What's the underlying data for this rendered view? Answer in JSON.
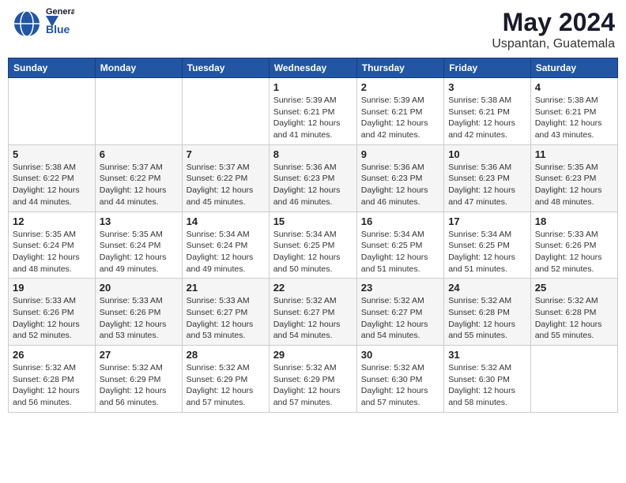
{
  "header": {
    "logo_line1": "General",
    "logo_line2": "Blue",
    "title": "May 2024",
    "subtitle": "Uspantan, Guatemala"
  },
  "days_of_week": [
    "Sunday",
    "Monday",
    "Tuesday",
    "Wednesday",
    "Thursday",
    "Friday",
    "Saturday"
  ],
  "weeks": [
    [
      {
        "day": "",
        "info": ""
      },
      {
        "day": "",
        "info": ""
      },
      {
        "day": "",
        "info": ""
      },
      {
        "day": "1",
        "info": "Sunrise: 5:39 AM\nSunset: 6:21 PM\nDaylight: 12 hours\nand 41 minutes."
      },
      {
        "day": "2",
        "info": "Sunrise: 5:39 AM\nSunset: 6:21 PM\nDaylight: 12 hours\nand 42 minutes."
      },
      {
        "day": "3",
        "info": "Sunrise: 5:38 AM\nSunset: 6:21 PM\nDaylight: 12 hours\nand 42 minutes."
      },
      {
        "day": "4",
        "info": "Sunrise: 5:38 AM\nSunset: 6:21 PM\nDaylight: 12 hours\nand 43 minutes."
      }
    ],
    [
      {
        "day": "5",
        "info": "Sunrise: 5:38 AM\nSunset: 6:22 PM\nDaylight: 12 hours\nand 44 minutes."
      },
      {
        "day": "6",
        "info": "Sunrise: 5:37 AM\nSunset: 6:22 PM\nDaylight: 12 hours\nand 44 minutes."
      },
      {
        "day": "7",
        "info": "Sunrise: 5:37 AM\nSunset: 6:22 PM\nDaylight: 12 hours\nand 45 minutes."
      },
      {
        "day": "8",
        "info": "Sunrise: 5:36 AM\nSunset: 6:23 PM\nDaylight: 12 hours\nand 46 minutes."
      },
      {
        "day": "9",
        "info": "Sunrise: 5:36 AM\nSunset: 6:23 PM\nDaylight: 12 hours\nand 46 minutes."
      },
      {
        "day": "10",
        "info": "Sunrise: 5:36 AM\nSunset: 6:23 PM\nDaylight: 12 hours\nand 47 minutes."
      },
      {
        "day": "11",
        "info": "Sunrise: 5:35 AM\nSunset: 6:23 PM\nDaylight: 12 hours\nand 48 minutes."
      }
    ],
    [
      {
        "day": "12",
        "info": "Sunrise: 5:35 AM\nSunset: 6:24 PM\nDaylight: 12 hours\nand 48 minutes."
      },
      {
        "day": "13",
        "info": "Sunrise: 5:35 AM\nSunset: 6:24 PM\nDaylight: 12 hours\nand 49 minutes."
      },
      {
        "day": "14",
        "info": "Sunrise: 5:34 AM\nSunset: 6:24 PM\nDaylight: 12 hours\nand 49 minutes."
      },
      {
        "day": "15",
        "info": "Sunrise: 5:34 AM\nSunset: 6:25 PM\nDaylight: 12 hours\nand 50 minutes."
      },
      {
        "day": "16",
        "info": "Sunrise: 5:34 AM\nSunset: 6:25 PM\nDaylight: 12 hours\nand 51 minutes."
      },
      {
        "day": "17",
        "info": "Sunrise: 5:34 AM\nSunset: 6:25 PM\nDaylight: 12 hours\nand 51 minutes."
      },
      {
        "day": "18",
        "info": "Sunrise: 5:33 AM\nSunset: 6:26 PM\nDaylight: 12 hours\nand 52 minutes."
      }
    ],
    [
      {
        "day": "19",
        "info": "Sunrise: 5:33 AM\nSunset: 6:26 PM\nDaylight: 12 hours\nand 52 minutes."
      },
      {
        "day": "20",
        "info": "Sunrise: 5:33 AM\nSunset: 6:26 PM\nDaylight: 12 hours\nand 53 minutes."
      },
      {
        "day": "21",
        "info": "Sunrise: 5:33 AM\nSunset: 6:27 PM\nDaylight: 12 hours\nand 53 minutes."
      },
      {
        "day": "22",
        "info": "Sunrise: 5:32 AM\nSunset: 6:27 PM\nDaylight: 12 hours\nand 54 minutes."
      },
      {
        "day": "23",
        "info": "Sunrise: 5:32 AM\nSunset: 6:27 PM\nDaylight: 12 hours\nand 54 minutes."
      },
      {
        "day": "24",
        "info": "Sunrise: 5:32 AM\nSunset: 6:28 PM\nDaylight: 12 hours\nand 55 minutes."
      },
      {
        "day": "25",
        "info": "Sunrise: 5:32 AM\nSunset: 6:28 PM\nDaylight: 12 hours\nand 55 minutes."
      }
    ],
    [
      {
        "day": "26",
        "info": "Sunrise: 5:32 AM\nSunset: 6:28 PM\nDaylight: 12 hours\nand 56 minutes."
      },
      {
        "day": "27",
        "info": "Sunrise: 5:32 AM\nSunset: 6:29 PM\nDaylight: 12 hours\nand 56 minutes."
      },
      {
        "day": "28",
        "info": "Sunrise: 5:32 AM\nSunset: 6:29 PM\nDaylight: 12 hours\nand 57 minutes."
      },
      {
        "day": "29",
        "info": "Sunrise: 5:32 AM\nSunset: 6:29 PM\nDaylight: 12 hours\nand 57 minutes."
      },
      {
        "day": "30",
        "info": "Sunrise: 5:32 AM\nSunset: 6:30 PM\nDaylight: 12 hours\nand 57 minutes."
      },
      {
        "day": "31",
        "info": "Sunrise: 5:32 AM\nSunset: 6:30 PM\nDaylight: 12 hours\nand 58 minutes."
      },
      {
        "day": "",
        "info": ""
      }
    ]
  ]
}
